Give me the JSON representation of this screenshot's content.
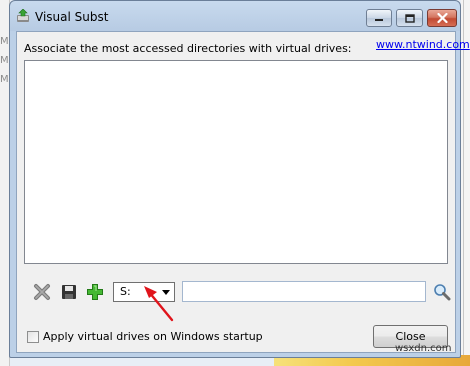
{
  "window": {
    "title": "Visual Subst",
    "icon": "visual-subst-app-icon"
  },
  "titlebar_buttons": {
    "minimize": "minimize-icon",
    "maximize": "maximize-icon",
    "close": "close-icon"
  },
  "main": {
    "description": "Associate the most accessed directories with virtual drives:",
    "link": "www.ntwind.com",
    "drive_list_items": []
  },
  "toolbar": {
    "remove_icon": "remove-x-icon",
    "save_icon": "floppy-disk-icon",
    "add_icon": "green-plus-icon",
    "drive_value": "S:",
    "path_value": "",
    "browse_icon": "magnifier-icon"
  },
  "footer": {
    "startup_checkbox_label": "Apply virtual drives on Windows startup",
    "startup_checked": false,
    "close_label": "Close"
  },
  "annotation": {
    "arrow_color": "#e0141b"
  },
  "background": {
    "left_strip_marks": [
      "M",
      "M",
      "M"
    ],
    "watermark": "wsxdn.com"
  },
  "colors": {
    "accent_link": "#0000ee",
    "close_button_red": "#c24a33"
  }
}
